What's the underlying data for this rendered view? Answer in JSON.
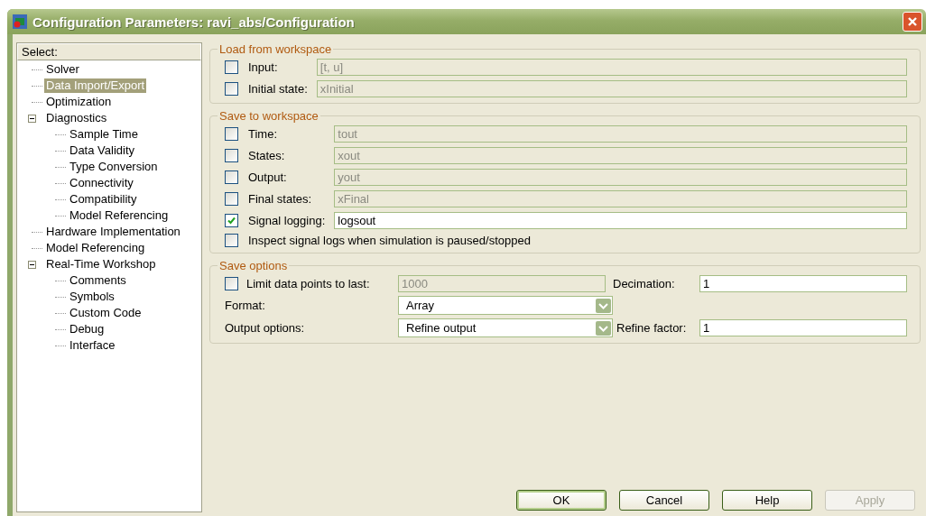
{
  "window": {
    "title": "Configuration Parameters: ravi_abs/Configuration"
  },
  "tree": {
    "header": "Select:",
    "items": [
      {
        "label": "Solver",
        "selected": false
      },
      {
        "label": "Data Import/Export",
        "selected": true
      },
      {
        "label": "Optimization",
        "selected": false
      },
      {
        "label": "Diagnostics",
        "selected": false,
        "expanded": true,
        "children": [
          {
            "label": "Sample Time",
            "selected": false
          },
          {
            "label": "Data Validity",
            "selected": false
          },
          {
            "label": "Type Conversion",
            "selected": false
          },
          {
            "label": "Connectivity",
            "selected": false
          },
          {
            "label": "Compatibility",
            "selected": false
          },
          {
            "label": "Model Referencing",
            "selected": false
          }
        ]
      },
      {
        "label": "Hardware Implementation",
        "selected": false
      },
      {
        "label": "Model Referencing",
        "selected": false
      },
      {
        "label": "Real-Time Workshop",
        "selected": false,
        "expanded": true,
        "children": [
          {
            "label": "Comments",
            "selected": false
          },
          {
            "label": "Symbols",
            "selected": false
          },
          {
            "label": "Custom Code",
            "selected": false
          },
          {
            "label": "Debug",
            "selected": false
          },
          {
            "label": "Interface",
            "selected": false
          }
        ]
      }
    ]
  },
  "groups": [
    {
      "title": "Load from workspace",
      "rows": [
        {
          "kind": "field",
          "label": "Input:",
          "checked": false,
          "value": "[t, u]",
          "disabled": true
        },
        {
          "kind": "field",
          "label": "Initial state:",
          "checked": false,
          "value": "xInitial",
          "disabled": true
        }
      ]
    },
    {
      "title": "Save to workspace",
      "rows": [
        {
          "kind": "field",
          "label": "Time:",
          "checked": false,
          "value": "tout",
          "disabled": true
        },
        {
          "kind": "field",
          "label": "States:",
          "checked": false,
          "value": "xout",
          "disabled": true
        },
        {
          "kind": "field",
          "label": "Output:",
          "checked": false,
          "value": "yout",
          "disabled": true
        },
        {
          "kind": "field",
          "label": "Final states:",
          "checked": false,
          "value": "xFinal",
          "disabled": true
        },
        {
          "kind": "field",
          "label": "Signal logging:",
          "checked": true,
          "value": "logsout",
          "disabled": false
        },
        {
          "kind": "check",
          "label": "Inspect signal logs when simulation is paused/stopped",
          "checked": false
        }
      ]
    }
  ],
  "save_options": {
    "title": "Save options",
    "limit": {
      "label": "Limit data points to last:",
      "checked": false,
      "value": "1000",
      "disabled": true
    },
    "decimation": {
      "label": "Decimation:",
      "value": "1"
    },
    "format": {
      "label": "Format:",
      "value": "Array"
    },
    "output_options": {
      "label": "Output options:",
      "value": "Refine output"
    },
    "refine_factor": {
      "label": "Refine factor:",
      "value": "1"
    }
  },
  "buttons": [
    {
      "label": "OK",
      "default": true,
      "disabled": false
    },
    {
      "label": "Cancel",
      "default": false,
      "disabled": false
    },
    {
      "label": "Help",
      "default": false,
      "disabled": false
    },
    {
      "label": "Apply",
      "default": false,
      "disabled": true
    }
  ]
}
